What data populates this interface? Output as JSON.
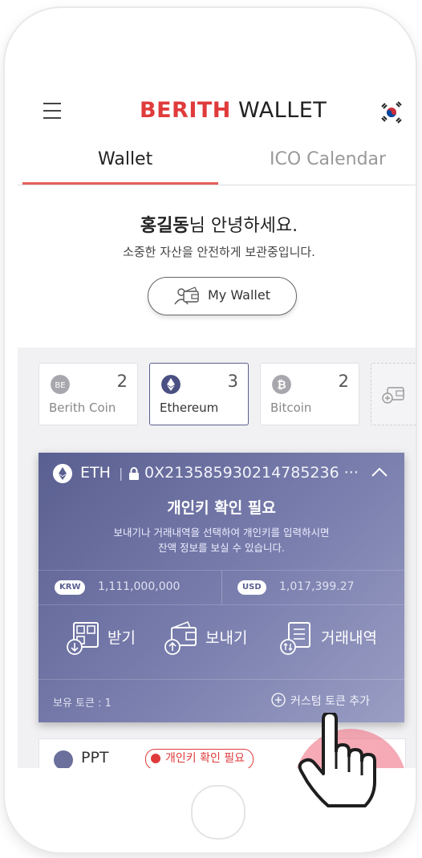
{
  "header": {
    "logo_brand": "BERITH",
    "logo_suffix": "WALLET",
    "menu_icon": "hamburger-menu-icon",
    "flag_icon": "korea-flag-icon"
  },
  "tabs": [
    {
      "label": "Wallet",
      "active": true
    },
    {
      "label": "ICO Calendar",
      "active": false
    }
  ],
  "greeting": {
    "name": "홍길동",
    "title_suffix": "님 안녕하세요.",
    "subtitle": "소중한 자산을 안전하게 보관중입니다.",
    "my_wallet_label": "My Wallet"
  },
  "coins": [
    {
      "name": "Berith Coin",
      "count": "2",
      "selected": false,
      "icon": "berith-coin-icon"
    },
    {
      "name": "Ethereum",
      "count": "3",
      "selected": true,
      "icon": "ethereum-icon"
    },
    {
      "name": "Bitcoin",
      "count": "2",
      "selected": false,
      "icon": "bitcoin-icon"
    }
  ],
  "eth_panel": {
    "symbol": "ETH",
    "address": "0X213585930214785236 ···",
    "warning_title": "개인키 확인 필요",
    "warning_line1": "보내기나 거래내역을 선택하여 개인키를 입력하시면",
    "warning_line2": "잔액 정보를 보실 수 있습니다.",
    "krw_label": "KRW",
    "krw_value": "1,111,000,000",
    "usd_label": "USD",
    "usd_value": "1,017,399.27",
    "actions": [
      {
        "label": "받기",
        "icon": "qr-receive-icon"
      },
      {
        "label": "보내기",
        "icon": "wallet-send-icon"
      },
      {
        "label": "거래내역",
        "icon": "transaction-history-icon"
      }
    ],
    "holding_label": "보유 토큰 : 1",
    "add_token_label": "커스텀 토큰 추가"
  },
  "next_card": {
    "symbol": "PPT",
    "warning": "개인키 확인 필요"
  },
  "colors": {
    "brand_red": "#e03b3b",
    "panel_purple": "#5a5f91",
    "tab_underline": "#e8605c"
  }
}
